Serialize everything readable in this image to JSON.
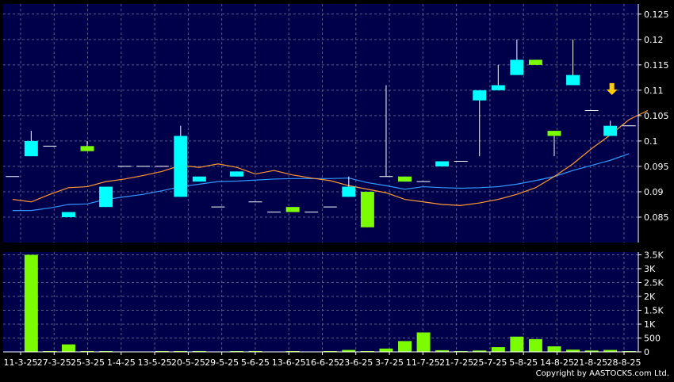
{
  "copyright": "Copyright by AASTOCKS.com Ltd.",
  "colors": {
    "background": "#000000",
    "plot_bg": "#00004a",
    "grid": "#5a5a8a",
    "up_candle": "#00ffff",
    "down_candle": "#7cfc00",
    "ma_short": "#ff9933",
    "ma_long": "#3399ff",
    "volume": "#7cfc00",
    "arrow": "#ffcc00"
  },
  "chart_data": [
    {
      "type": "candlestick",
      "ylim": [
        0.08,
        0.127
      ],
      "y_ticks": [
        "0.085",
        "0.09",
        "0.095",
        "0.1",
        "0.105",
        "0.11",
        "0.115",
        "0.12",
        "0.125"
      ],
      "x_ticks": [
        "11-3-25",
        "27-3-25",
        "25-3-25",
        "1-4-25",
        "13-5-25",
        "20-5-25",
        "29-5-25",
        "5-6-25",
        "13-6-25",
        "16-6-25",
        "23-6-25",
        "3-7-25",
        "11-7-25",
        "21-7-25",
        "25-7-25",
        "5-8-25",
        "14-8-25",
        "21-8-25",
        "28-8-25"
      ],
      "candles": [
        {
          "o": 0.093,
          "h": 0.093,
          "l": 0.093,
          "c": 0.093
        },
        {
          "o": 0.097,
          "h": 0.102,
          "l": 0.097,
          "c": 0.1
        },
        {
          "o": 0.099,
          "h": 0.099,
          "l": 0.099,
          "c": 0.099
        },
        {
          "o": 0.085,
          "h": 0.086,
          "l": 0.085,
          "c": 0.086
        },
        {
          "o": 0.099,
          "h": 0.1,
          "l": 0.098,
          "c": 0.098
        },
        {
          "o": 0.087,
          "h": 0.091,
          "l": 0.087,
          "c": 0.091
        },
        {
          "o": 0.095,
          "h": 0.095,
          "l": 0.095,
          "c": 0.095
        },
        {
          "o": 0.095,
          "h": 0.095,
          "l": 0.095,
          "c": 0.095
        },
        {
          "o": 0.095,
          "h": 0.095,
          "l": 0.095,
          "c": 0.095
        },
        {
          "o": 0.089,
          "h": 0.103,
          "l": 0.089,
          "c": 0.101
        },
        {
          "o": 0.092,
          "h": 0.093,
          "l": 0.092,
          "c": 0.093
        },
        {
          "o": 0.087,
          "h": 0.087,
          "l": 0.087,
          "c": 0.087
        },
        {
          "o": 0.093,
          "h": 0.094,
          "l": 0.093,
          "c": 0.094
        },
        {
          "o": 0.088,
          "h": 0.088,
          "l": 0.088,
          "c": 0.088
        },
        {
          "o": 0.086,
          "h": 0.086,
          "l": 0.086,
          "c": 0.086
        },
        {
          "o": 0.087,
          "h": 0.087,
          "l": 0.086,
          "c": 0.086
        },
        {
          "o": 0.086,
          "h": 0.086,
          "l": 0.086,
          "c": 0.086
        },
        {
          "o": 0.087,
          "h": 0.087,
          "l": 0.087,
          "c": 0.087
        },
        {
          "o": 0.089,
          "h": 0.093,
          "l": 0.089,
          "c": 0.091
        },
        {
          "o": 0.09,
          "h": 0.09,
          "l": 0.083,
          "c": 0.083
        },
        {
          "o": 0.093,
          "h": 0.111,
          "l": 0.093,
          "c": 0.093
        },
        {
          "o": 0.093,
          "h": 0.093,
          "l": 0.092,
          "c": 0.092
        },
        {
          "o": 0.092,
          "h": 0.092,
          "l": 0.092,
          "c": 0.092
        },
        {
          "o": 0.095,
          "h": 0.096,
          "l": 0.095,
          "c": 0.096
        },
        {
          "o": 0.096,
          "h": 0.096,
          "l": 0.096,
          "c": 0.096
        },
        {
          "o": 0.108,
          "h": 0.11,
          "l": 0.097,
          "c": 0.11
        },
        {
          "o": 0.11,
          "h": 0.115,
          "l": 0.11,
          "c": 0.111
        },
        {
          "o": 0.113,
          "h": 0.12,
          "l": 0.113,
          "c": 0.116
        },
        {
          "o": 0.116,
          "h": 0.116,
          "l": 0.115,
          "c": 0.115
        },
        {
          "o": 0.102,
          "h": 0.102,
          "l": 0.097,
          "c": 0.101
        },
        {
          "o": 0.111,
          "h": 0.12,
          "l": 0.111,
          "c": 0.113
        },
        {
          "o": 0.106,
          "h": 0.106,
          "l": 0.106,
          "c": 0.106
        },
        {
          "o": 0.101,
          "h": 0.104,
          "l": 0.101,
          "c": 0.103
        },
        {
          "o": 0.103,
          "h": 0.103,
          "l": 0.103,
          "c": 0.103
        }
      ],
      "ma_short": [
        0.0885,
        0.088,
        0.0895,
        0.0908,
        0.091,
        0.092,
        0.0925,
        0.0932,
        0.094,
        0.0952,
        0.0948,
        0.0955,
        0.0948,
        0.0935,
        0.0942,
        0.0933,
        0.0927,
        0.0922,
        0.0912,
        0.0905,
        0.0898,
        0.0885,
        0.088,
        0.0875,
        0.0873,
        0.0878,
        0.0885,
        0.0895,
        0.0908,
        0.093,
        0.0955,
        0.0985,
        0.1012,
        0.1042,
        0.106
      ],
      "ma_long": [
        0.0863,
        0.0863,
        0.0868,
        0.0875,
        0.0876,
        0.0885,
        0.089,
        0.0895,
        0.0902,
        0.091,
        0.0915,
        0.092,
        0.0921,
        0.0923,
        0.0925,
        0.0926,
        0.0926,
        0.0926,
        0.0927,
        0.0918,
        0.0912,
        0.0905,
        0.091,
        0.0908,
        0.0907,
        0.0908,
        0.091,
        0.0915,
        0.0922,
        0.093,
        0.0942,
        0.0952,
        0.0962,
        0.0975
      ],
      "arrow_value": 0.11
    },
    {
      "type": "bar",
      "ylim": [
        0,
        3600
      ],
      "y_ticks": [
        "0",
        "500",
        "1K",
        "1.5K",
        "2K",
        "2.5K",
        "3K",
        "3.5K"
      ],
      "values": [
        0,
        3500,
        20,
        270,
        15,
        10,
        0,
        0,
        20,
        20,
        30,
        0,
        20,
        30,
        0,
        10,
        0,
        20,
        70,
        10,
        120,
        390,
        700,
        60,
        30,
        50,
        170,
        550,
        460,
        200,
        80,
        50,
        70,
        20
      ]
    }
  ]
}
